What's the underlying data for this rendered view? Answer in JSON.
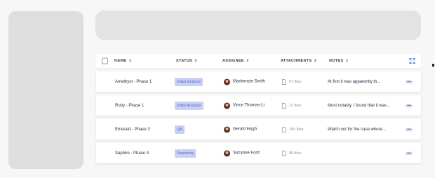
{
  "table": {
    "headers": {
      "name": "NAME",
      "status": "STATUS",
      "assignee": "ASSIGNEE",
      "attachments": "ATTACHMENTS",
      "notes": "NOTES"
    },
    "sort_glyph": "⇕",
    "rows": [
      {
        "name": "Amethyst - Phase 1",
        "status": "Initial analysis",
        "assignee": "Mackenzie Smith",
        "attachments": "67 files",
        "note": "At first it was apparently th..."
      },
      {
        "name": "Ruby - Phase 1",
        "status": "Initial Analysis",
        "assignee": "Vince Thomas-Li",
        "attachments": "12 files",
        "note": "Most notably, I found that it was..."
      },
      {
        "name": "Emerald - Phase 3",
        "status": "QA",
        "assignee": "Gerald Hugh",
        "attachments": "105 files",
        "note": "Watch out for the case where..."
      },
      {
        "name": "Saphire - Phase 4",
        "status": "Reporting",
        "assignee": "Suzanne Ford",
        "attachments": "88 files",
        "note": ""
      }
    ]
  },
  "colors": {
    "accent": "#5a6fd6",
    "badge_bg": "#c9d0f2",
    "badge_text": "#5b68c9",
    "placeholder": "#dedede"
  },
  "icons": {
    "expand": "expand-arrows-icon",
    "file": "file-icon",
    "more": "more-dots-icon"
  }
}
